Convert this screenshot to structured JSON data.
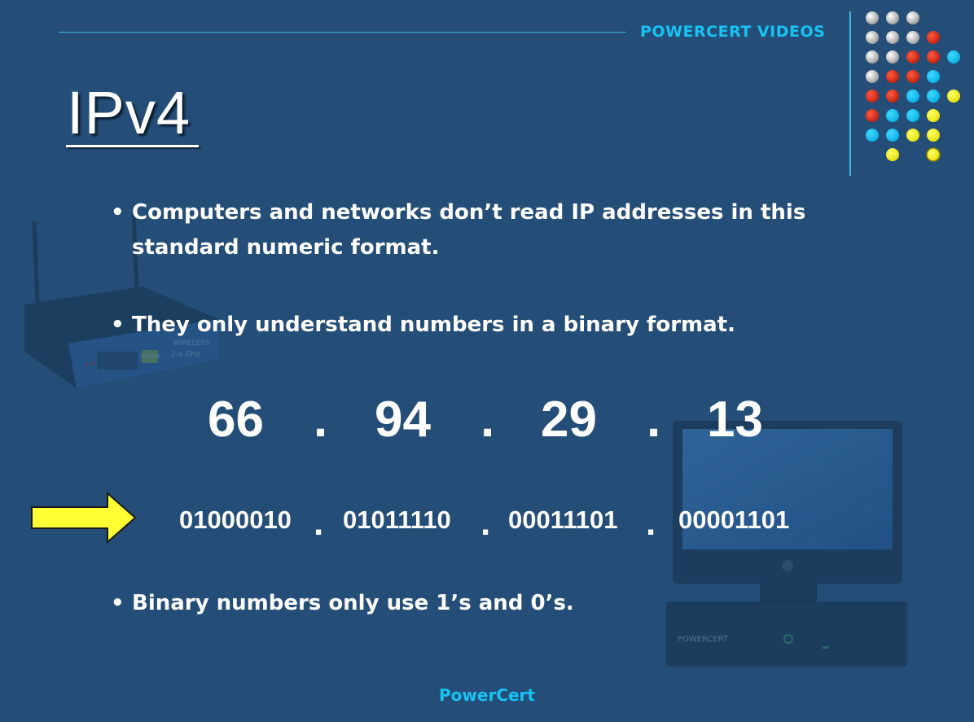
{
  "header": {
    "brand": "POWERCERT VIDEOS"
  },
  "title": "IPv4",
  "bullets": [
    "Computers and networks don’t read IP addresses in this standard numeric format.",
    "They only understand numbers in a binary format.",
    "Binary numbers only use 1’s and 0’s."
  ],
  "address": {
    "decimal": [
      "66",
      "94",
      "29",
      "13"
    ],
    "binary": [
      "01000010",
      "01011110",
      "00011101",
      "00001101"
    ],
    "separator": "."
  },
  "router_label": {
    "brand": "WIRELESS",
    "band": "2.4 GHz",
    "mode": "ROUTER"
  },
  "computer_label": "POWERCERT",
  "footer": "PowerCert",
  "colors": {
    "background": "#244e77",
    "accent": "#17c3f3",
    "arrow": "#ffff33",
    "dot_red": "#e8321e",
    "dot_yellow": "#f5ef1a",
    "dot_gray": "#c8c8c8"
  },
  "icons": [
    "router-image",
    "computer-image",
    "arrow-right-icon",
    "decorative-dot-grid"
  ]
}
